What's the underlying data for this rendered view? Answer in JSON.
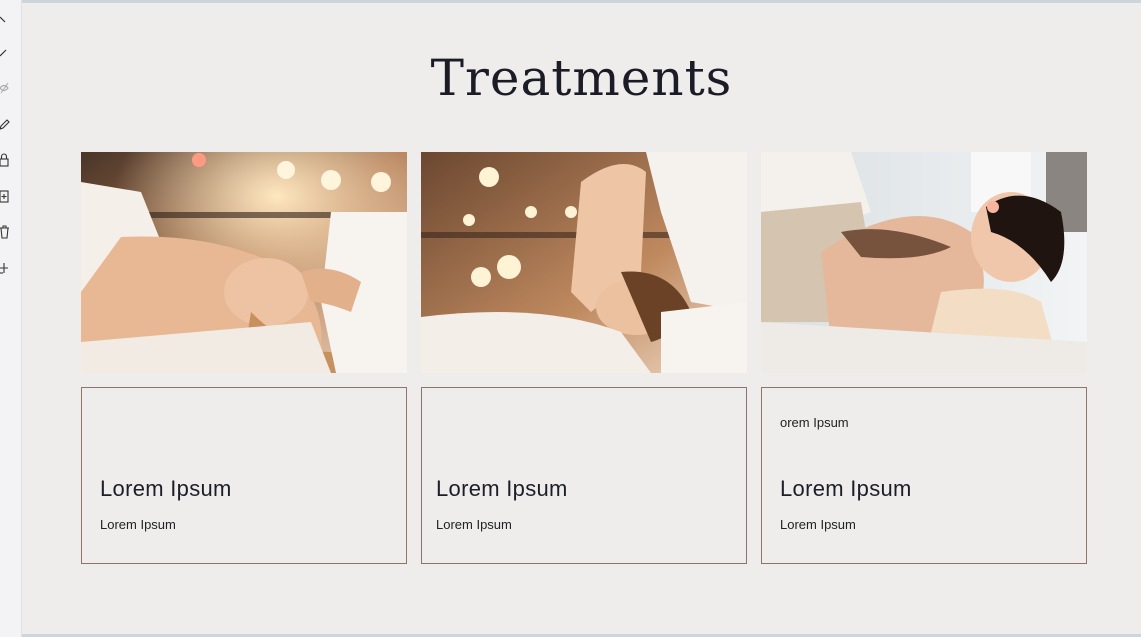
{
  "section": {
    "title": "Treatments"
  },
  "cards": [
    {
      "top_text": "",
      "heading": "Lorem Ipsum",
      "subtext": "Lorem Ipsum"
    },
    {
      "top_text": "",
      "heading": "Lorem Ipsum",
      "subtext": "Lorem Ipsum"
    },
    {
      "top_text": "orem Ipsum",
      "heading": "Lorem Ipsum",
      "subtext": "Lorem Ipsum"
    }
  ],
  "toolbar": {
    "icons": [
      "chevron-up-icon",
      "line-icon",
      "eye-off-icon",
      "pencil-icon",
      "lock-icon",
      "add-page-icon",
      "trash-icon",
      "add-element-icon"
    ]
  },
  "colors": {
    "background": "#eeedeb",
    "card_border": "#8f7468",
    "title": "#1c1c26"
  }
}
